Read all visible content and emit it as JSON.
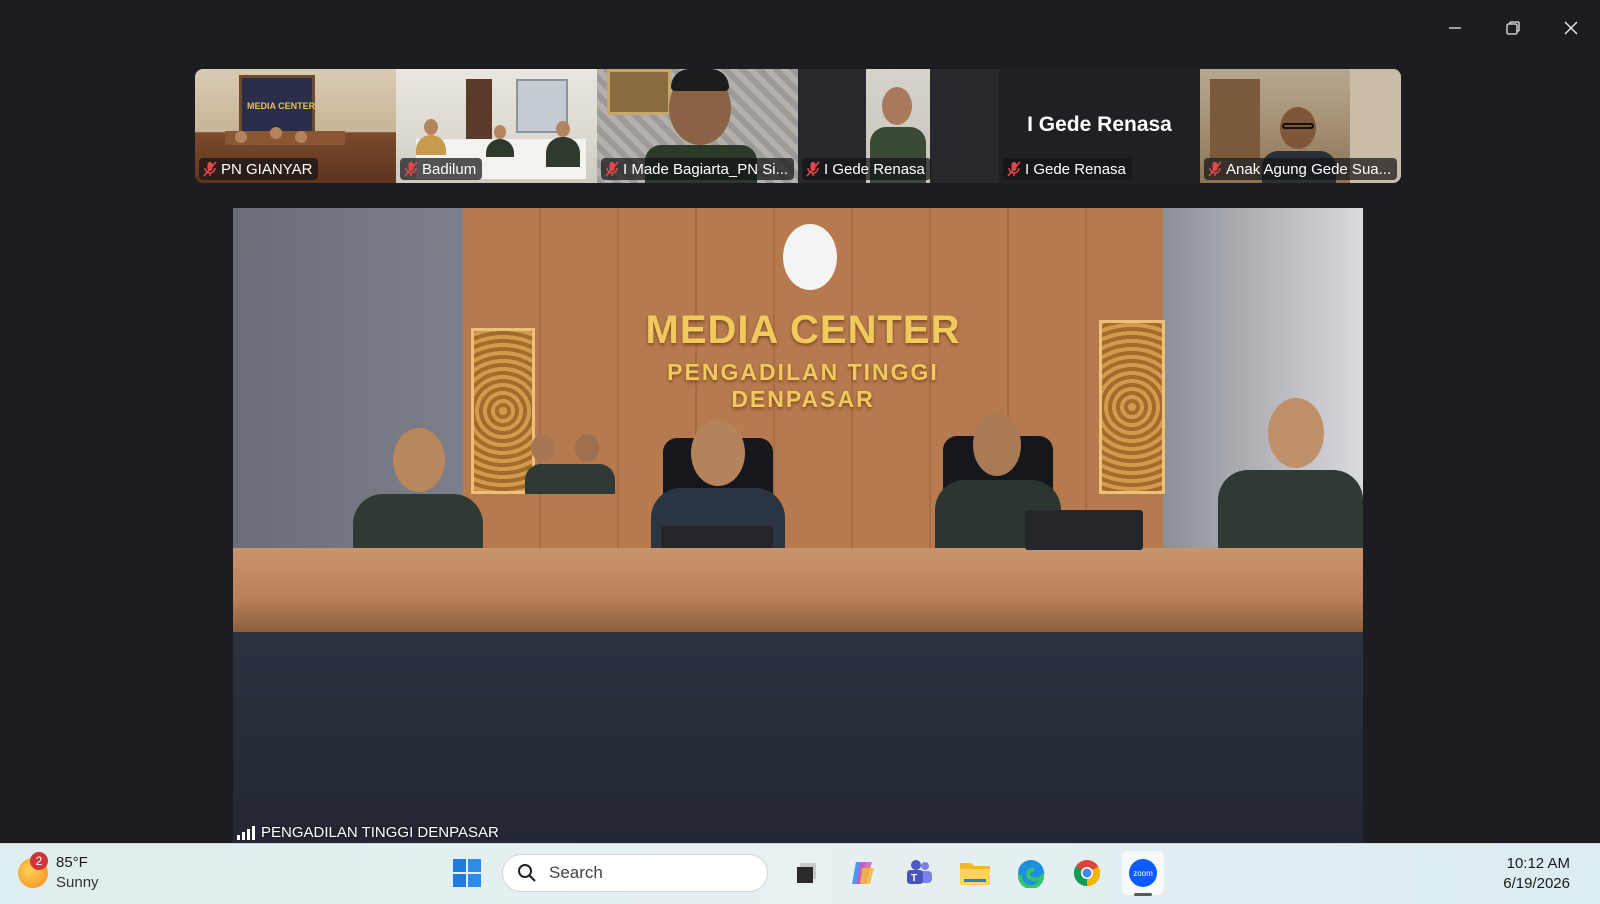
{
  "window": {
    "minimize_label": "Minimize",
    "restore_label": "Restore",
    "close_label": "Close"
  },
  "participants": [
    {
      "name": "PN GIANYAR",
      "muted": true,
      "video": true
    },
    {
      "name": "Badilum",
      "muted": true,
      "video": true
    },
    {
      "name": "I Made Bagiarta_PN Si...",
      "muted": true,
      "video": true
    },
    {
      "name": "I Gede Renasa",
      "muted": true,
      "video": true
    },
    {
      "name": "I Gede Renasa",
      "display_name": "I Gede Renasa",
      "muted": true,
      "video": false
    },
    {
      "name": "Anak Agung Gede Sua...",
      "muted": true,
      "video": true
    }
  ],
  "main_video": {
    "participant": "PENGADILAN TINGGI DENPASAR",
    "scene_text": {
      "line1": "MEDIA CENTER",
      "line2": "PENGADILAN TINGGI",
      "line3": "DENPASAR"
    }
  },
  "taskbar": {
    "weather": {
      "temperature": "85°F",
      "condition": "Sunny",
      "badge": "2"
    },
    "search_placeholder": "Search",
    "apps": [
      "start-icon",
      "task-view-icon",
      "copilot-icon",
      "teams-icon",
      "file-explorer-icon",
      "edge-icon",
      "chrome-icon",
      "zoom-icon"
    ],
    "active_app": "zoom-icon",
    "zoom_label": "zoom",
    "time": "10:12 AM",
    "date": "6/19/2026"
  },
  "colors": {
    "mic_muted": "#e5484d",
    "taskbar_bg": "#e3eff1",
    "window_bg": "#1b1d21"
  }
}
